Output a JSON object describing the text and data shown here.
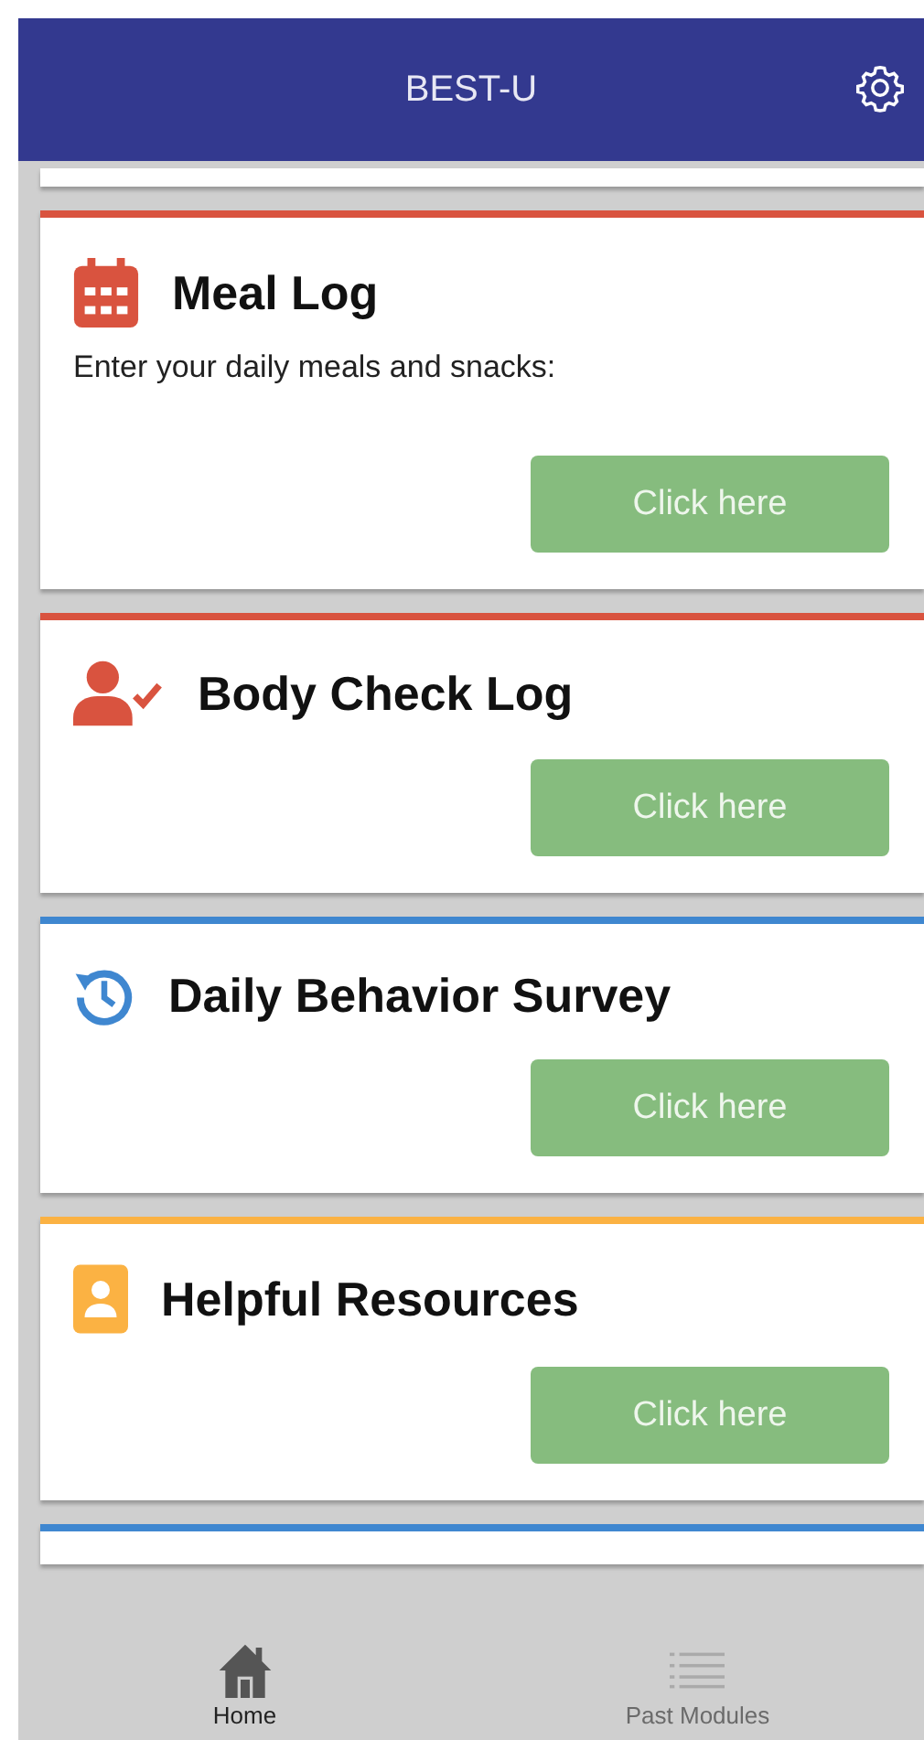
{
  "header": {
    "title": "BEST-U"
  },
  "cards": [
    {
      "kind": "partial"
    },
    {
      "kind": "calendar",
      "color": "#d9533f",
      "title": "Meal Log",
      "description": "Enter your daily meals and snacks:",
      "button": "Click here"
    },
    {
      "kind": "person",
      "color": "#d9533f",
      "title": "Body Check Log",
      "button": "Click here"
    },
    {
      "kind": "history",
      "color": "#3f87d0",
      "title": "Daily Behavior Survey",
      "button": "Click here"
    },
    {
      "kind": "contacts",
      "color": "#fbb243",
      "title": "Helpful Resources",
      "button": "Click here"
    },
    {
      "kind": "partial",
      "color": "#3f87d0"
    }
  ],
  "nav": [
    {
      "label": "Home",
      "kind": "home",
      "selected": true
    },
    {
      "label": "Past Modules",
      "kind": "list",
      "selected": false
    }
  ]
}
